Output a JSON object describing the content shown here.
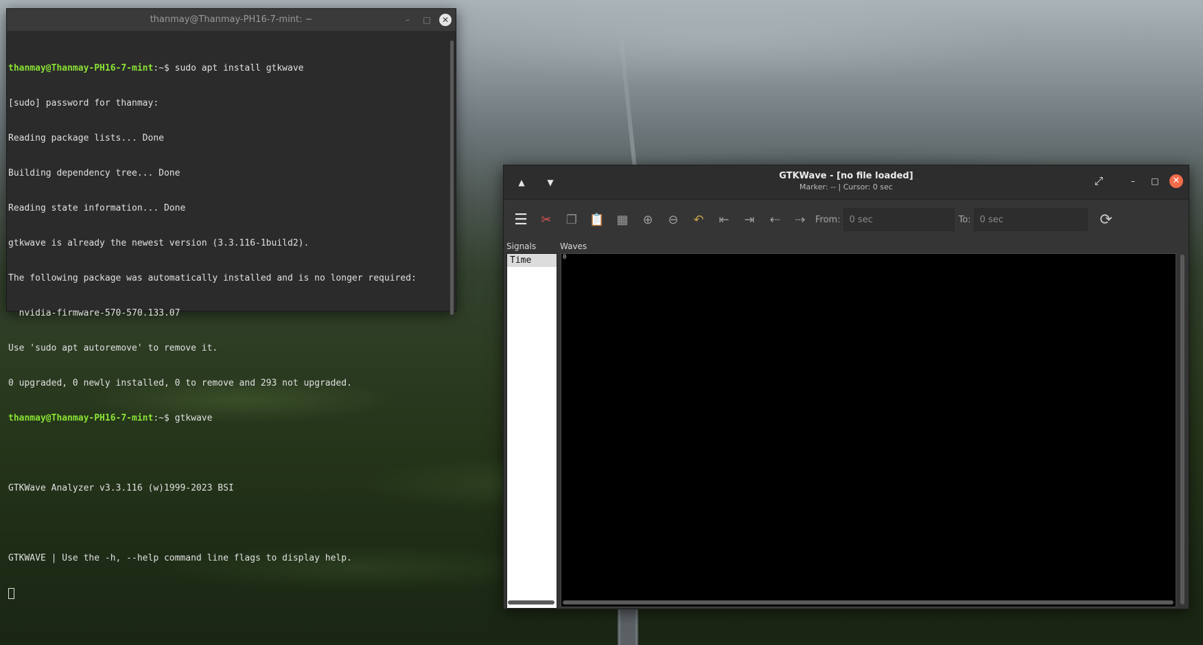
{
  "terminal": {
    "title": "thanmay@Thanmay-PH16-7-mint: ~",
    "prompt_user": "thanmay@Thanmay-PH16-7-mint",
    "prompt_path": ":~$ ",
    "commands": [
      "sudo apt install gtkwave",
      "gtkwave"
    ],
    "output1": [
      "[sudo] password for thanmay:",
      "Reading package lists... Done",
      "Building dependency tree... Done",
      "Reading state information... Done",
      "gtkwave is already the newest version (3.3.116-1build2).",
      "The following package was automatically installed and is no longer required:",
      "  nvidia-firmware-570-570.133.07",
      "Use 'sudo apt autoremove' to remove it.",
      "0 upgraded, 0 newly installed, 0 to remove and 293 not upgraded."
    ],
    "output2": [
      "",
      "GTKWave Analyzer v3.3.116 (w)1999-2023 BSI",
      "",
      "GTKWAVE | Use the -h, --help command line flags to display help."
    ]
  },
  "gtkwave": {
    "title": "GTKWave - [no file loaded]",
    "subtitle": "Marker: --  |  Cursor: 0 sec",
    "toolbar": {
      "from_label": "From:",
      "from_value": "0 sec",
      "to_label": "To:",
      "to_value": "0 sec"
    },
    "signals_label": "Signals",
    "waves_label": "Waves",
    "signals": [
      "Time"
    ],
    "waves_origin": "0"
  },
  "icons": {
    "up": "triangle-up",
    "down": "triangle-down",
    "expand": "expand-arrows",
    "reload": "refresh"
  }
}
